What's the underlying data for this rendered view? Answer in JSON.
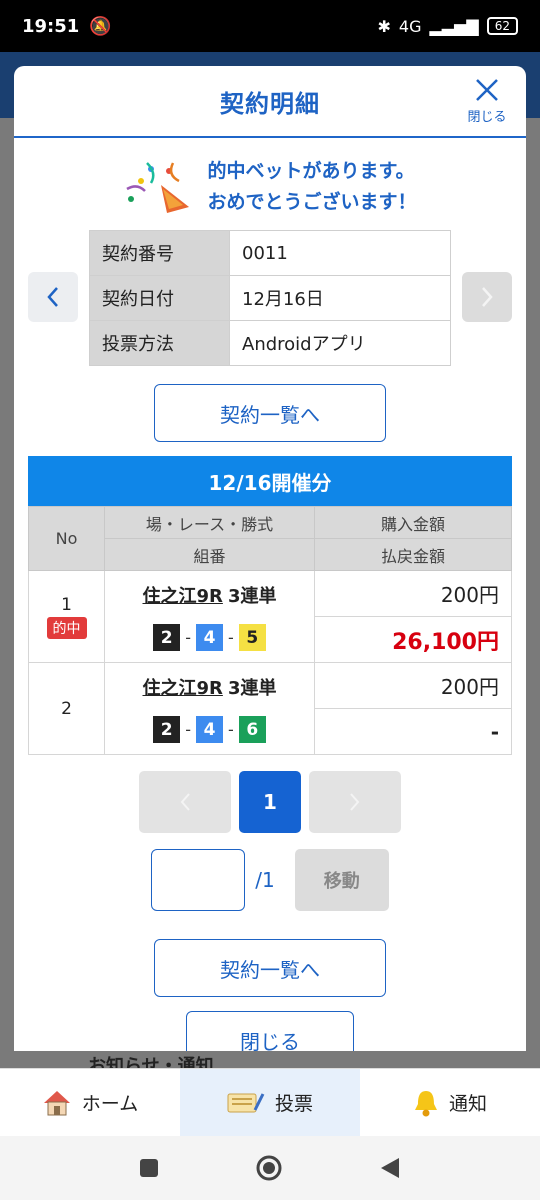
{
  "status": {
    "time": "19:51",
    "network": "4G",
    "battery": "62"
  },
  "modal": {
    "title": "契約明細",
    "close_label": "閉じる",
    "hit_line1": "的中ベットがあります。",
    "hit_line2": "おめでとうございます！",
    "info": [
      {
        "key": "契約番号",
        "value": "0011"
      },
      {
        "key": "契約日付",
        "value": "12月16日"
      },
      {
        "key": "投票方法",
        "value": "Androidアプリ"
      }
    ],
    "list_button": "契約一覧へ",
    "race_heading": "12/16開催分",
    "table_head": {
      "no": "No",
      "race": "場・レース・勝式",
      "combo": "組番",
      "purchase": "購入金額",
      "refund": "払戻金額"
    },
    "bets": [
      {
        "no": "1",
        "badge": "的中",
        "race": "住之江9R",
        "kind": "3連単",
        "balls": [
          "2",
          "4",
          "5"
        ],
        "purchase": "200円",
        "refund": "26,100円"
      },
      {
        "no": "2",
        "race": "住之江9R",
        "kind": "3連単",
        "balls": [
          "2",
          "4",
          "6"
        ],
        "purchase": "200円",
        "refund": "-"
      }
    ],
    "pager": {
      "current": "1",
      "total_label": "/1",
      "move_label": "移動",
      "input_value": ""
    },
    "list_button_2": "契約一覧へ",
    "close_button": "閉じる"
  },
  "background": {
    "peek_text": "お知らせ・通知"
  },
  "tabs": [
    {
      "label": "ホーム",
      "icon": "home-icon"
    },
    {
      "label": "投票",
      "icon": "ticket-icon"
    },
    {
      "label": "通知",
      "icon": "bell-icon"
    }
  ],
  "ball_colors": {
    "2": "#222222",
    "4": "#3d8bef",
    "5": "#f5e043",
    "6": "#1aa05a"
  },
  "ball_text_colors": {
    "2": "#ffffff",
    "4": "#ffffff",
    "5": "#222222",
    "6": "#ffffff"
  }
}
